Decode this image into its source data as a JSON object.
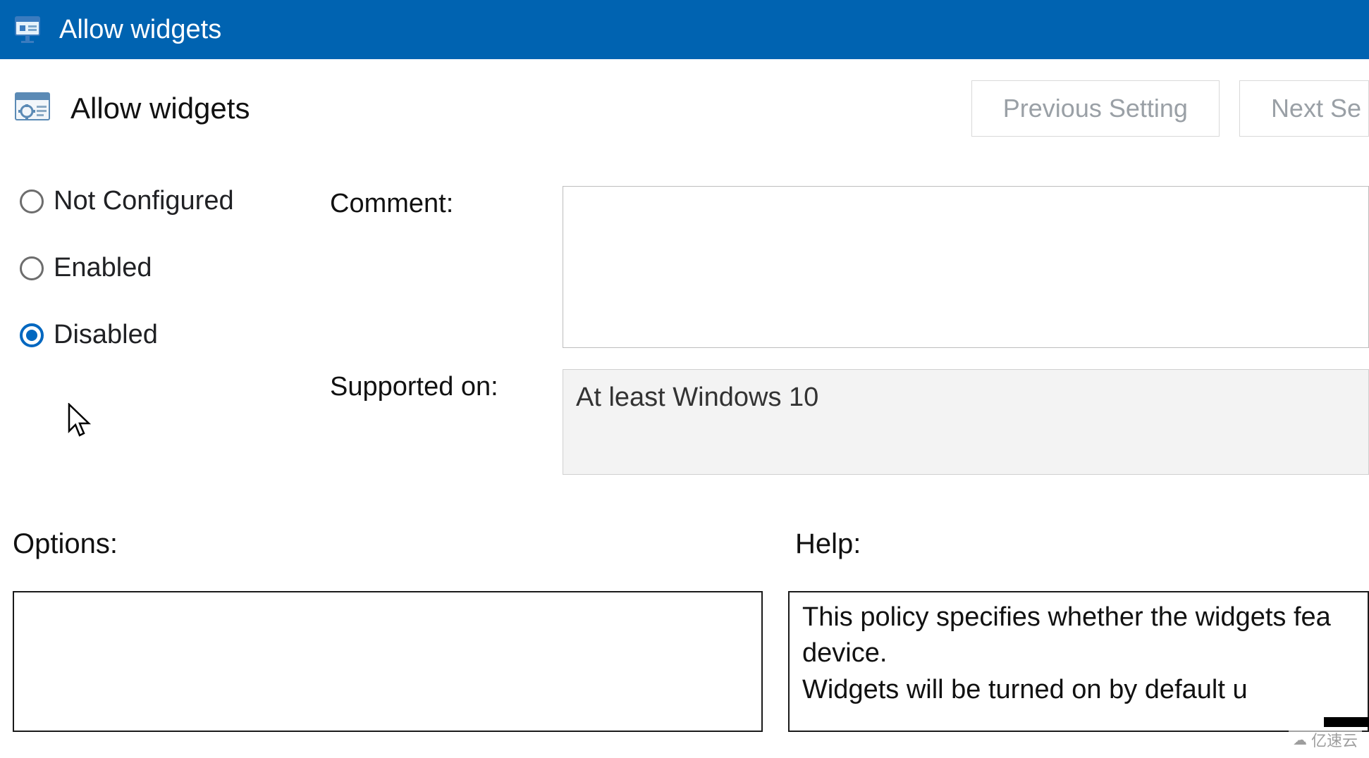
{
  "titlebar": {
    "title": "Allow widgets"
  },
  "header": {
    "policy_name": "Allow widgets",
    "prev_label": "Previous Setting",
    "next_label": "Next Se"
  },
  "state": {
    "options": [
      {
        "label": "Not Configured",
        "selected": false
      },
      {
        "label": "Enabled",
        "selected": false
      },
      {
        "label": "Disabled",
        "selected": true
      }
    ],
    "comment_label": "Comment:",
    "comment_value": "",
    "supported_label": "Supported on:",
    "supported_value": "At least Windows 10"
  },
  "lower": {
    "options_label": "Options:",
    "help_label": "Help:",
    "help_text": "This policy specifies whether the widgets fea\ndevice.\nWidgets will be turned on by default u"
  },
  "watermark": "亿速云"
}
